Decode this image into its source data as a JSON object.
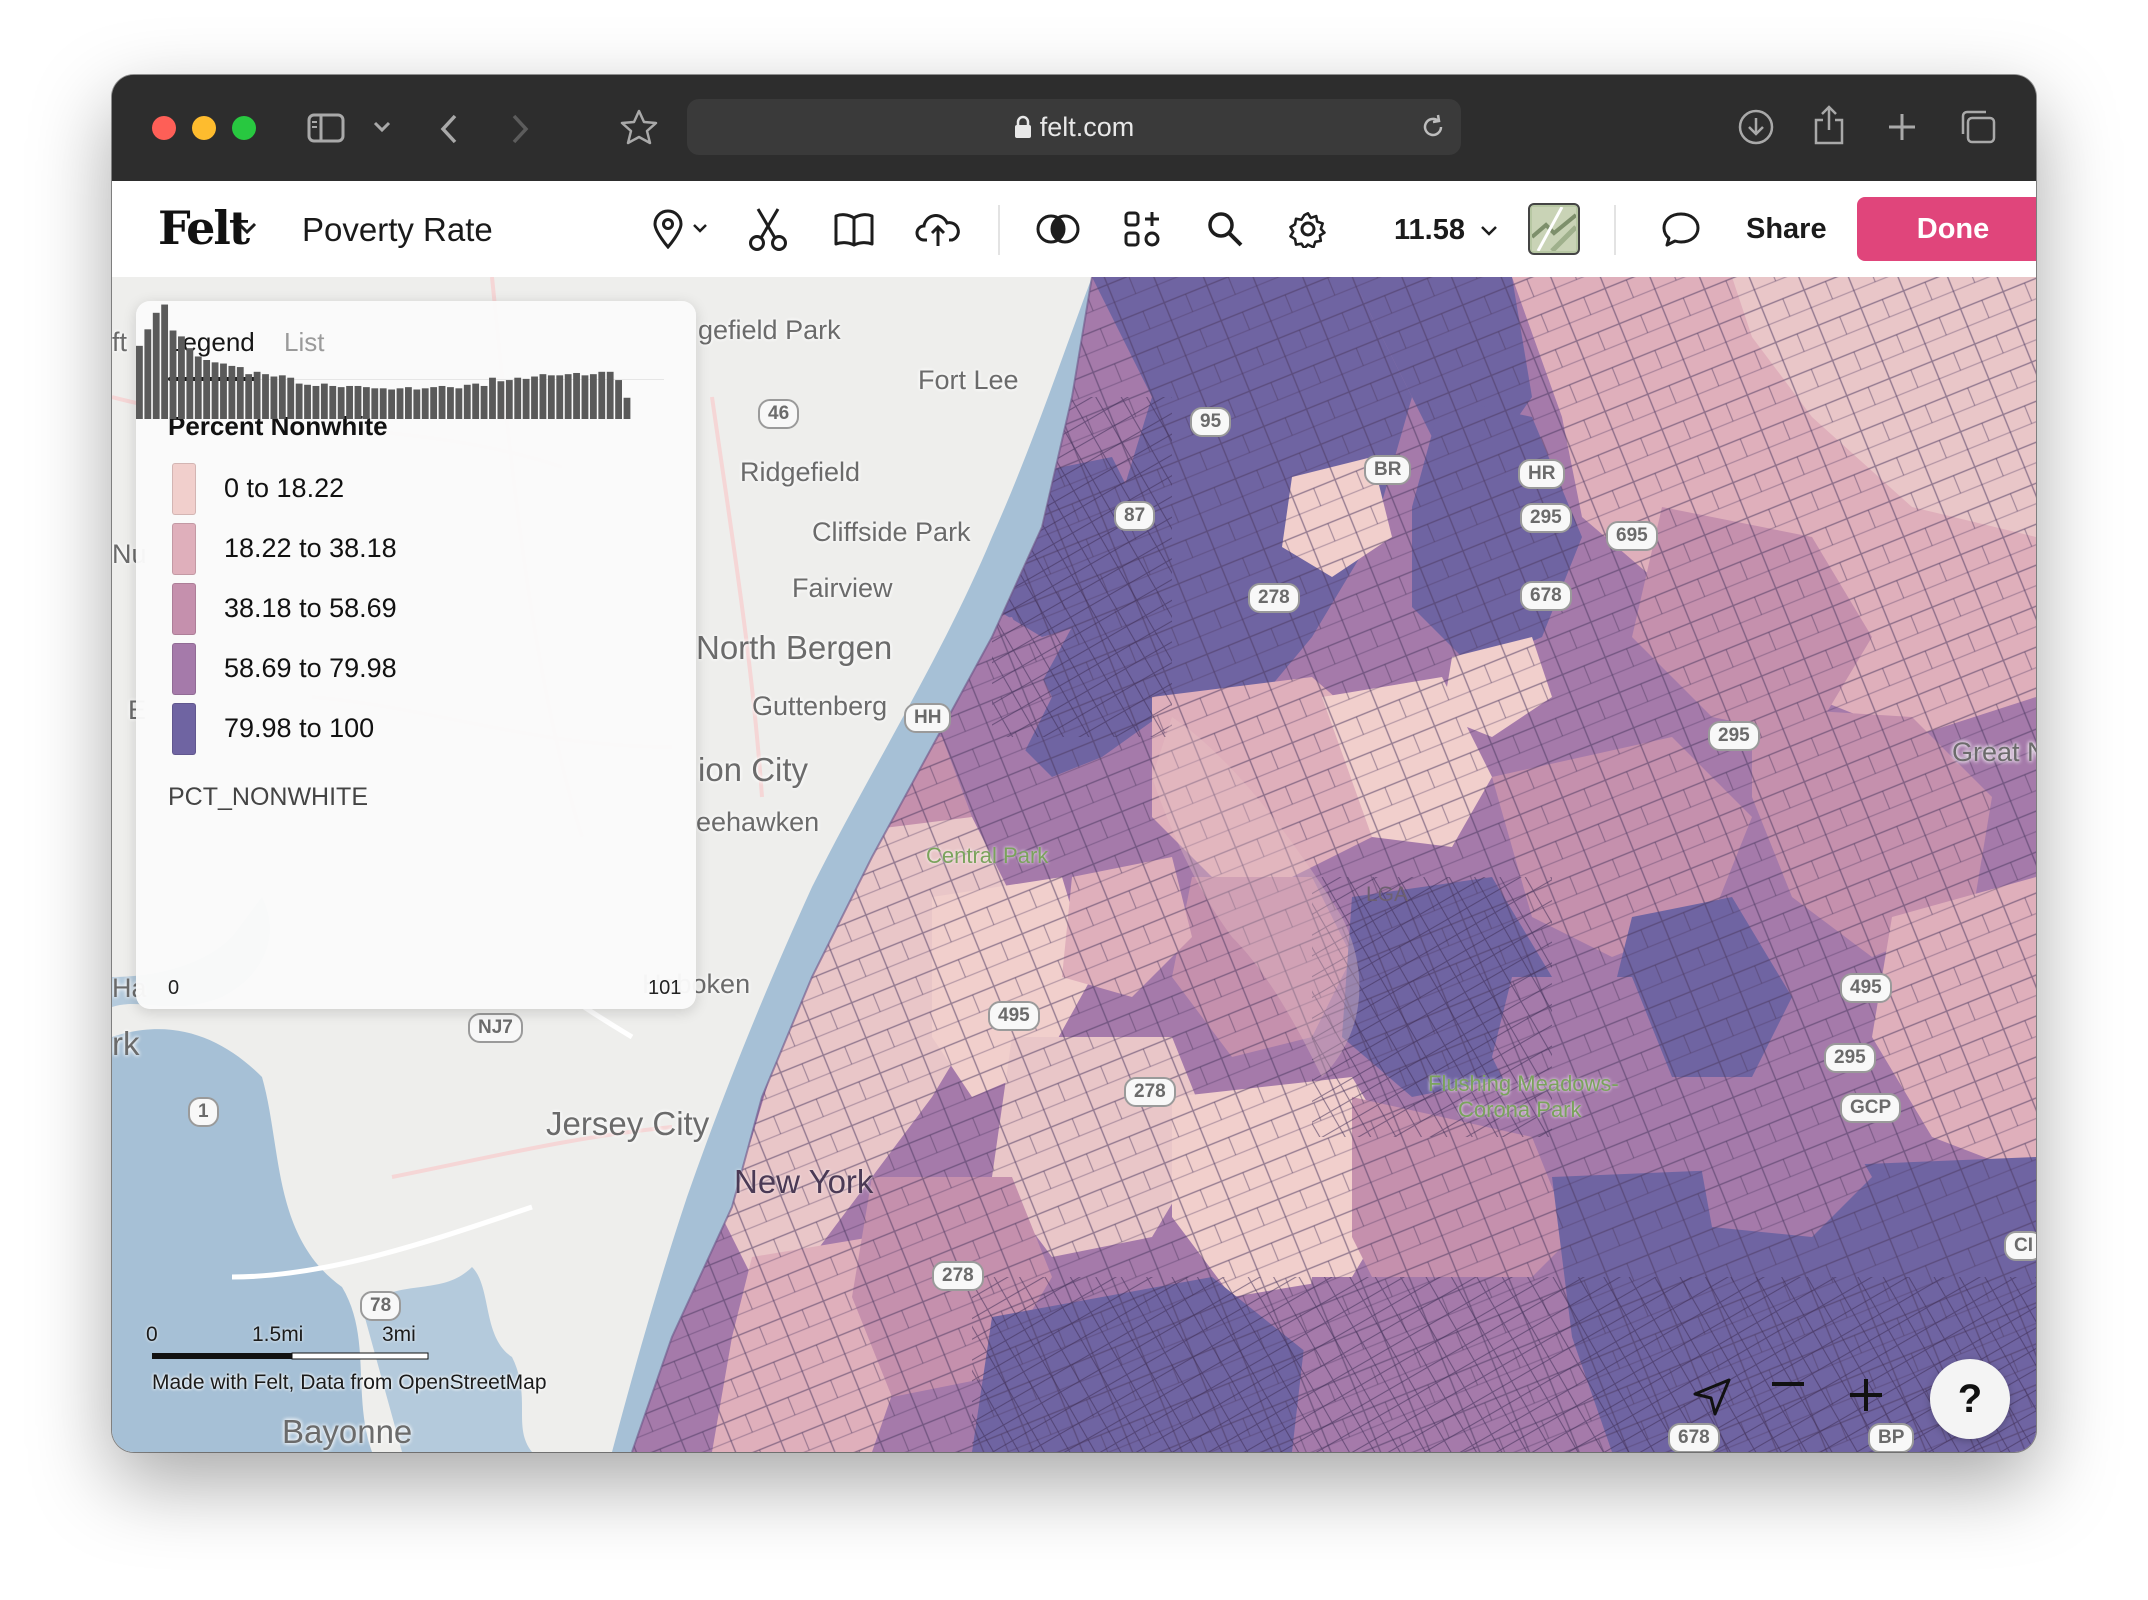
{
  "browser": {
    "url": "felt.com"
  },
  "app": {
    "logo": "Felt",
    "map_title": "Poverty Rate",
    "zoom_level": "11.58",
    "share_label": "Share",
    "done_label": "Done",
    "accent_color": "#e0457b"
  },
  "legend": {
    "tabs": [
      "Legend",
      "List"
    ],
    "active_tab": "Legend",
    "title": "Percent Nonwhite",
    "items": [
      {
        "label": "0 to 18.22",
        "color": "#f1cfcc"
      },
      {
        "label": "18.22 to 38.18",
        "color": "#dfafbb"
      },
      {
        "label": "38.18 to 58.69",
        "color": "#c590ad"
      },
      {
        "label": "58.69 to 79.98",
        "color": "#a57aaa"
      },
      {
        "label": "79.98 to 100",
        "color": "#6f64a2"
      }
    ],
    "field_name": "PCT_NONWHITE",
    "histogram": {
      "min_label": "0",
      "max_label": "101",
      "bar_heights_relative": [
        0.62,
        0.76,
        0.9,
        0.97,
        0.75,
        0.7,
        0.6,
        0.53,
        0.5,
        0.48,
        0.47,
        0.45,
        0.44,
        0.38,
        0.4,
        0.38,
        0.36,
        0.37,
        0.35,
        0.3,
        0.29,
        0.28,
        0.3,
        0.28,
        0.27,
        0.28,
        0.28,
        0.27,
        0.26,
        0.26,
        0.25,
        0.26,
        0.27,
        0.25,
        0.26,
        0.27,
        0.28,
        0.27,
        0.26,
        0.29,
        0.3,
        0.28,
        0.35,
        0.32,
        0.33,
        0.35,
        0.34,
        0.36,
        0.38,
        0.37,
        0.37,
        0.38,
        0.39,
        0.37,
        0.38,
        0.4,
        0.4,
        0.33,
        0.18
      ]
    }
  },
  "map": {
    "places": [
      {
        "name": "gefield Park",
        "style": "normal"
      },
      {
        "name": "Fort Lee",
        "style": "normal"
      },
      {
        "name": "Ridgefield",
        "style": "normal"
      },
      {
        "name": "Cliffside Park",
        "style": "normal"
      },
      {
        "name": "Fairview",
        "style": "normal"
      },
      {
        "name": "North Bergen",
        "style": "large"
      },
      {
        "name": "Guttenberg",
        "style": "normal"
      },
      {
        "name": "ion City",
        "style": "large"
      },
      {
        "name": "eehawken",
        "style": "normal"
      },
      {
        "name": "Hoboken",
        "style": "normal"
      },
      {
        "name": "Jersey City",
        "style": "large"
      },
      {
        "name": "New York",
        "style": "large-on-map"
      },
      {
        "name": "Bayonne",
        "style": "large"
      },
      {
        "name": "Central Park",
        "style": "park"
      },
      {
        "name": "Flushing Meadows-",
        "style": "park"
      },
      {
        "name": "Corona Park",
        "style": "park"
      },
      {
        "name": "LGA",
        "style": "airport"
      },
      {
        "name": "Great N",
        "style": "normal"
      },
      {
        "name": "ft",
        "style": "normal"
      },
      {
        "name": "Nu",
        "style": "normal"
      },
      {
        "name": "E",
        "style": "normal"
      },
      {
        "name": "Ha",
        "style": "normal"
      },
      {
        "name": "rk",
        "style": "large"
      }
    ],
    "shields": [
      "46",
      "95",
      "BR",
      "HR",
      "87",
      "295",
      "695",
      "278",
      "678",
      "HH",
      "295",
      "495",
      "NJ7",
      "1",
      "278",
      "495",
      "295",
      "GCP",
      "278",
      "78",
      "CI",
      "678",
      "BP"
    ],
    "scale_labels": [
      "0",
      "1.5mi",
      "3mi"
    ],
    "attribution": "Made with Felt, Data from OpenStreetMap",
    "help_label": "?"
  }
}
